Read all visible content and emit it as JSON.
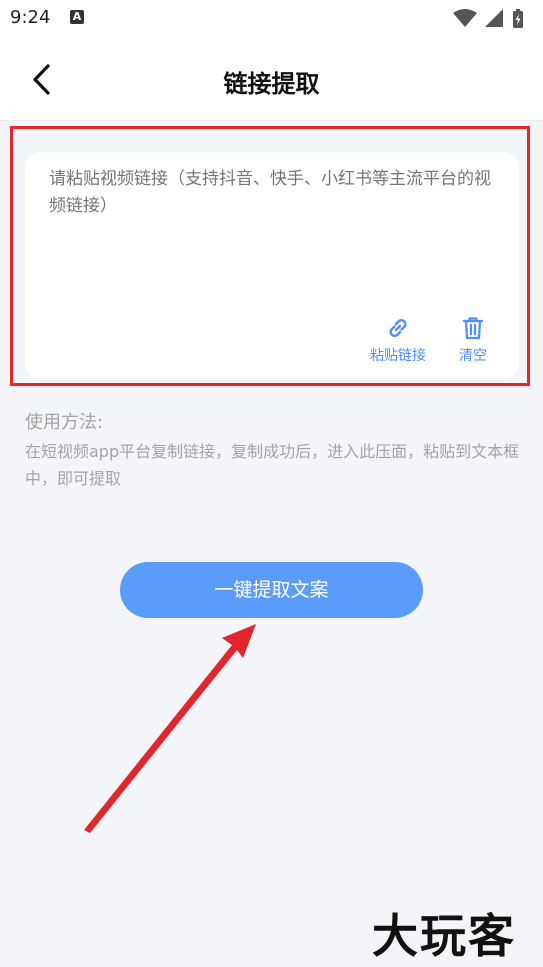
{
  "status": {
    "time": "9:24",
    "notification_letter": "A"
  },
  "header": {
    "title": "链接提取",
    "back_icon": "chevron-left-icon"
  },
  "input": {
    "placeholder": "请粘贴视频链接（支持抖音、快手、小红书等主流平台的视频链接）",
    "value": ""
  },
  "actions": {
    "paste_label": "粘贴链接",
    "paste_icon": "link-icon",
    "clear_label": "清空",
    "clear_icon": "trash-icon"
  },
  "usage": {
    "title": "使用方法:",
    "body": "在短视频app平台复制链接，复制成功后，进入此压面，粘贴到文本框中，即可提取"
  },
  "main_button": {
    "label": "一键提取文案"
  },
  "colors": {
    "accent": "#5a9cfb",
    "action_blue": "#4e8ef7",
    "highlight_red": "#e5262a",
    "background": "#f4f5f9"
  },
  "watermark": {
    "text": "大玩客"
  }
}
